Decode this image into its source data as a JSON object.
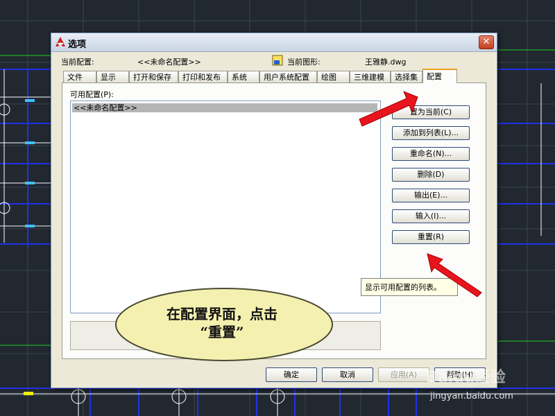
{
  "dialog": {
    "title": "选项",
    "current_profile_label": "当前配置:",
    "current_profile_value": "<<未命名配置>>",
    "current_drawing_label": "当前图形:",
    "current_drawing_value": "王雅静.dwg"
  },
  "tabs": [
    {
      "label": "文件"
    },
    {
      "label": "显示"
    },
    {
      "label": "打开和保存"
    },
    {
      "label": "打印和发布"
    },
    {
      "label": "系统"
    },
    {
      "label": "用户系统配置"
    },
    {
      "label": "绘图"
    },
    {
      "label": "三维建模"
    },
    {
      "label": "选择集"
    },
    {
      "label": "配置",
      "active": true
    }
  ],
  "profiles": {
    "label": "可用配置(P):",
    "items": [
      "<<未命名配置>>"
    ],
    "selected_index": 0
  },
  "side_buttons": {
    "set_current": "置为当前(C)",
    "add_to_list": "添加到列表(L)...",
    "rename": "重命名(N)...",
    "delete": "删除(D)",
    "export": "输出(E)...",
    "import": "输入(I)...",
    "reset": "重置(R)"
  },
  "tooltip": "显示可用配置的列表。",
  "bottom_buttons": {
    "ok": "确定",
    "cancel": "取消",
    "apply": "应用(A)",
    "help": "帮助(H)"
  },
  "annotation": {
    "line1": "在配置界面，点击",
    "line2": "“重置”"
  },
  "watermark": {
    "logo": "Baidu经验",
    "url": "jingyan.baidu.com"
  },
  "colors": {
    "cad_background": "#212830",
    "arrow": "#e8141e",
    "bubble_fill": "#f4f0b0",
    "active_tab_accent": "#f0a020"
  },
  "icons": {
    "app_logo": "autocad-logo-icon",
    "drawing": "drawing-file-icon",
    "close": "close-icon",
    "arrow": "red-arrow-icon"
  }
}
